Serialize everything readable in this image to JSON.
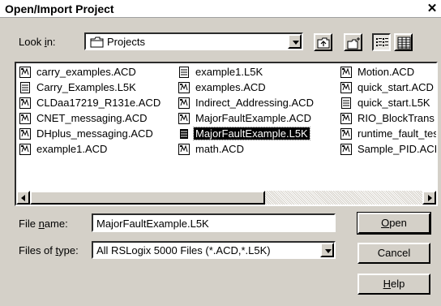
{
  "window": {
    "title": "Open/Import Project",
    "close_glyph": "✕"
  },
  "look_in": {
    "label_pre": "Look ",
    "label_acc": "i",
    "label_post": "n:",
    "value": "Projects"
  },
  "toolbar": {
    "up_icon": "up-one-level-icon",
    "new_folder_icon": "create-new-folder-icon",
    "list_icon": "list-view-icon",
    "details_icon": "details-view-icon"
  },
  "files": {
    "col1": [
      "carry_examples.ACD",
      "Carry_Examples.L5K",
      "CLDaa17219_R131e.ACD",
      "CNET_messaging.ACD",
      "DHplus_messaging.ACD",
      "example1.ACD"
    ],
    "col2": [
      "example1.L5K",
      "examples.ACD",
      "Indirect_Addressing.ACD",
      "MajorFaultExample.ACD",
      "MajorFaultExample.L5K",
      "math.ACD"
    ],
    "col3": [
      "Motion.ACD",
      "quick_start.ACD",
      "quick_start.L5K",
      "RIO_BlockTrans",
      "runtime_fault_tes",
      "Sample_PID.ACI"
    ]
  },
  "file_name": {
    "label_pre": "File ",
    "label_acc": "n",
    "label_post": "ame:",
    "value": "MajorFaultExample.L5K"
  },
  "files_of_type": {
    "label_pre": "Files of ",
    "label_acc": "t",
    "label_post": "ype:",
    "value": "All RSLogix 5000 Files (*.ACD,*.L5K)"
  },
  "buttons": {
    "open": {
      "acc": "O",
      "rest": "pen"
    },
    "cancel": {
      "label": "Cancel"
    },
    "help": {
      "acc": "H",
      "rest": "elp"
    }
  }
}
